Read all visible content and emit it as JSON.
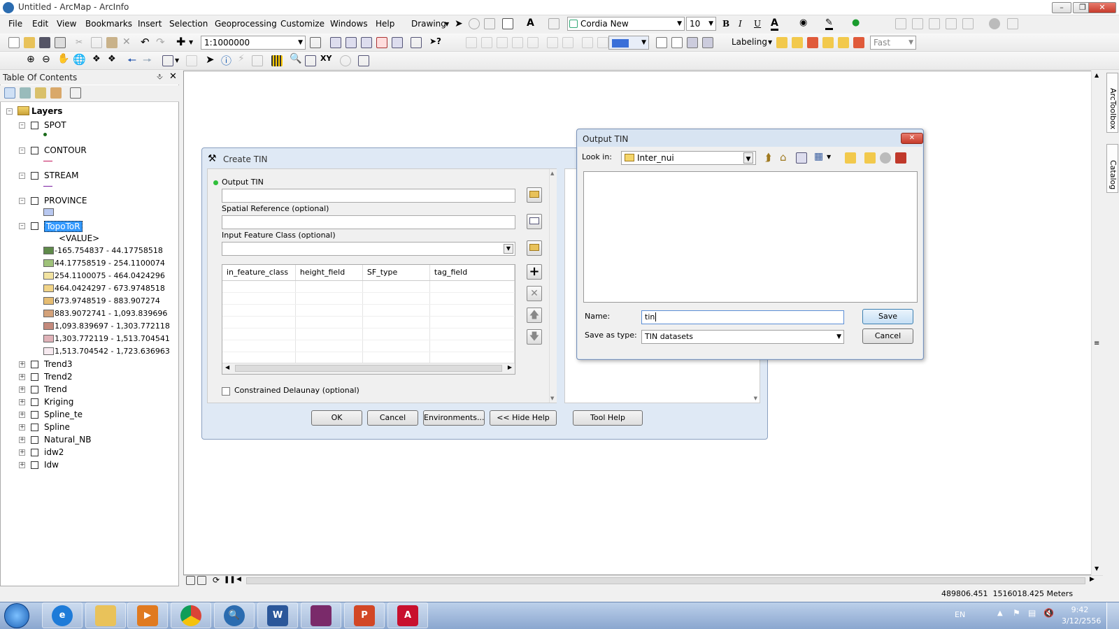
{
  "window": {
    "title": "Untitled - ArcMap - ArcInfo"
  },
  "menu": [
    "File",
    "Edit",
    "View",
    "Bookmarks",
    "Insert",
    "Selection",
    "Geoprocessing",
    "Customize",
    "Windows",
    "Help"
  ],
  "toolbar": {
    "drawing_label": "Drawing",
    "font_name": "Cordia New",
    "font_size": "10",
    "bold": "B",
    "italic": "I",
    "underline": "U",
    "scale": "1:1000000",
    "labeling_label": "Labeling",
    "quality": "Fast"
  },
  "toc": {
    "title": "Table Of Contents",
    "root": "Layers",
    "layers": [
      {
        "name": "SPOT",
        "symbol": "point"
      },
      {
        "name": "CONTOUR",
        "symbol": "line"
      },
      {
        "name": "STREAM",
        "symbol": "line"
      },
      {
        "name": "PROVINCE",
        "symbol": "fill"
      },
      {
        "name": "TopoToR",
        "symbol": "raster",
        "selected": true
      }
    ],
    "raster_field": "<VALUE>",
    "classes": [
      {
        "label": "-165.754837 - 44.17758518",
        "color": "#5f8a4a"
      },
      {
        "label": "44.17758519 - 254.1100074",
        "color": "#9fc27a"
      },
      {
        "label": "254.1100075 - 464.0424296",
        "color": "#f2e3a1"
      },
      {
        "label": "464.0424297 - 673.9748518",
        "color": "#f1d488"
      },
      {
        "label": "673.9748519 - 883.907274",
        "color": "#e6bd72"
      },
      {
        "label": "883.9072741 - 1,093.839696",
        "color": "#d4a27a"
      },
      {
        "label": "1,093.839697 - 1,303.772118",
        "color": "#c48a7c"
      },
      {
        "label": "1,303.772119 - 1,513.704541",
        "color": "#e0b2b8"
      },
      {
        "label": "1,513.704542 - 1,723.636963",
        "color": "#f7eaf0"
      }
    ],
    "more_layers": [
      "Trend3",
      "Trend2",
      "Trend",
      "Kriging",
      "Spline_te",
      "Spline",
      "Natural_NB",
      "idw2",
      "Idw"
    ]
  },
  "dock": {
    "arctoolbox": "ArcToolbox",
    "catalog": "Catalog"
  },
  "create_tin": {
    "title": "Create TIN",
    "output_label": "Output TIN",
    "spatial_ref_label": "Spatial Reference (optional)",
    "input_fc_label": "Input Feature Class (optional)",
    "columns": [
      "in_feature_class",
      "height_field",
      "SF_type",
      "tag_field"
    ],
    "constrained_label": "Constrained Delaunay (optional)",
    "buttons": {
      "ok": "OK",
      "cancel": "Cancel",
      "environments": "Environments...",
      "hide_help": "<< Hide Help",
      "tool_help": "Tool Help"
    }
  },
  "output_tin": {
    "title": "Output TIN",
    "look_in_label": "Look in:",
    "look_in_value": "Inter_nui",
    "name_label": "Name:",
    "name_value": "tin",
    "save_type_label": "Save as type:",
    "save_type_value": "TIN datasets",
    "save": "Save",
    "cancel": "Cancel"
  },
  "status": {
    "coords": "489806.451  1516018.425 Meters"
  },
  "taskbar": {
    "lang": "EN",
    "time": "9:42",
    "date": "3/12/2556"
  }
}
